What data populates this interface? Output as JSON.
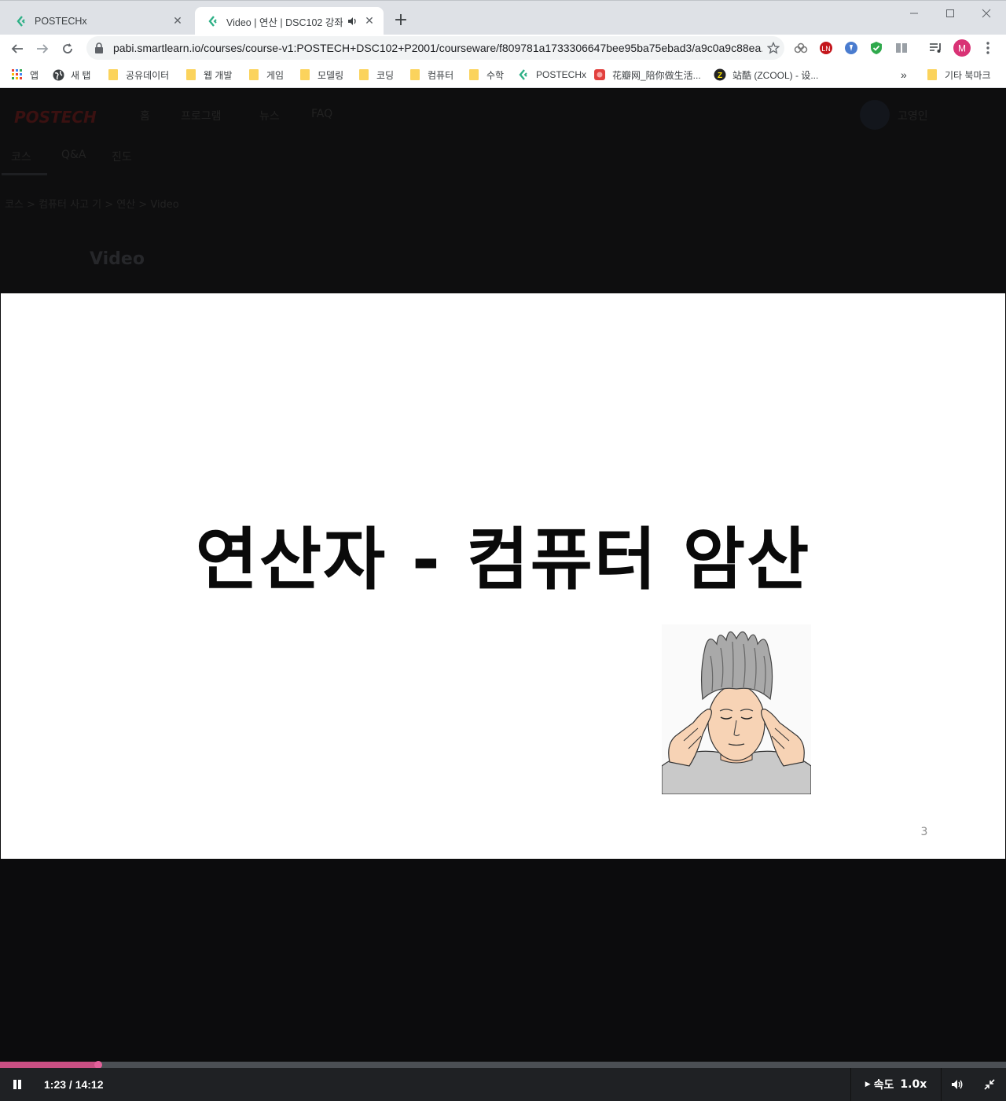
{
  "browser": {
    "tabs": [
      {
        "title": "POSTECHx"
      },
      {
        "title": "Video | 연산 | DSC102 강좌 | "
      }
    ],
    "url": "pabi.smartlearn.io/courses/course-v1:POSTECH+DSC102+P2001/courseware/f809781a1733306647bee95ba75ebad3/a9c0a9c88ea...",
    "profile_initial": "M"
  },
  "bookmarks": [
    {
      "label": "앱",
      "icon": "apps-grid-icon"
    },
    {
      "label": "새 탭",
      "icon": "globe-icon"
    },
    {
      "label": "공유데이터",
      "icon": "folder-icon"
    },
    {
      "label": "웹 개발",
      "icon": "folder-icon"
    },
    {
      "label": "게임",
      "icon": "folder-icon"
    },
    {
      "label": "모델링",
      "icon": "folder-icon"
    },
    {
      "label": "코딩",
      "icon": "folder-icon"
    },
    {
      "label": "컴퓨터",
      "icon": "folder-icon"
    },
    {
      "label": "수학",
      "icon": "folder-icon"
    },
    {
      "label": "POSTECHx",
      "icon": "postechx-icon"
    },
    {
      "label": "花瓣网_陪你做生活...",
      "icon": "huaban-icon"
    },
    {
      "label": "站酷 (ZCOOL) - 设...",
      "icon": "zcool-icon"
    }
  ],
  "bookmarks_overflow": "»",
  "other_bookmarks": "기타 북마크",
  "site": {
    "logo": "POSTECH",
    "nav": [
      "홈",
      "프로그램",
      "뉴스",
      "FAQ"
    ],
    "user": "고영인",
    "course_tabs": [
      "코스",
      "Q&A",
      "진도"
    ],
    "breadcrumb": "코스 > 컴퓨터 사고 기 > 연산 > Video",
    "unit_title": "Video"
  },
  "slide": {
    "title": "연산자 - 컴퓨터 암산",
    "page_number": "3"
  },
  "player": {
    "progress": 0.098,
    "time": "1:23 / 14:12",
    "speed_label": "속도",
    "speed_value": "1.0x"
  }
}
